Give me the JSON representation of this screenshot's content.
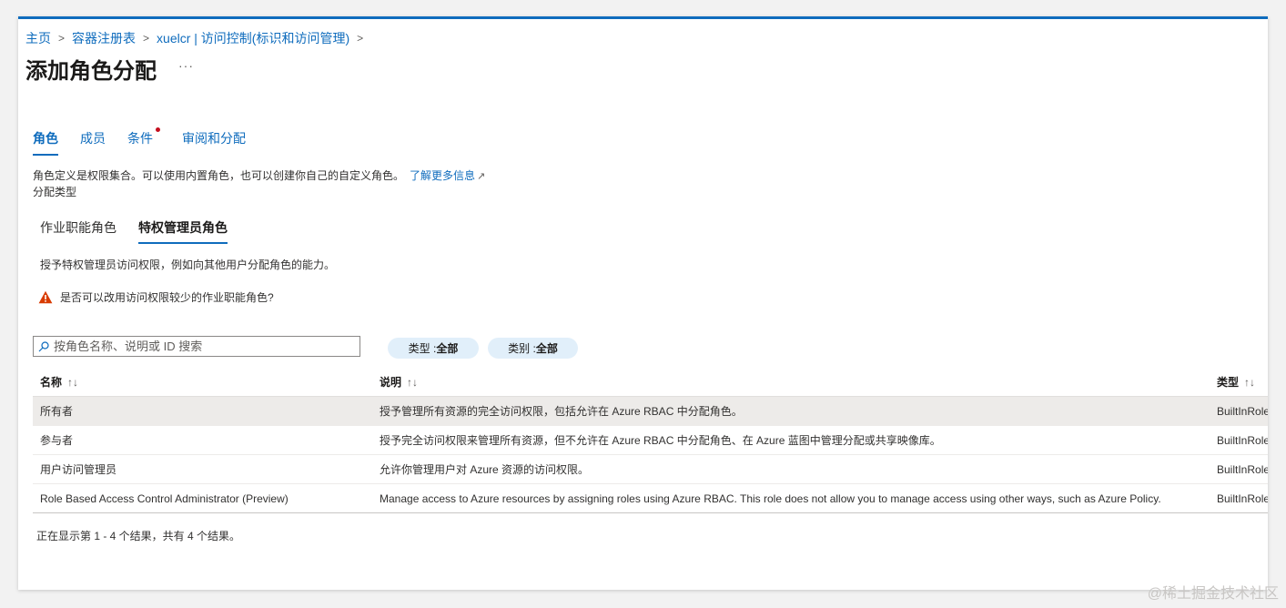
{
  "breadcrumb": {
    "items": [
      {
        "label": "主页"
      },
      {
        "label": "容器注册表"
      },
      {
        "label": "xuelcr | 访问控制(标识和访问管理)"
      }
    ]
  },
  "page": {
    "title": "添加角色分配",
    "more_label": "···"
  },
  "tabs": [
    {
      "label": "角色"
    },
    {
      "label": "成员"
    },
    {
      "label": "条件"
    },
    {
      "label": "审阅和分配"
    }
  ],
  "description": {
    "text": "角色定义是权限集合。可以使用内置角色，也可以创建你自己的自定义角色。",
    "link": "了解更多信息",
    "assign_type_label": "分配类型"
  },
  "subtabs": [
    {
      "label": "作业职能角色"
    },
    {
      "label": "特权管理员角色"
    }
  ],
  "subtab_description": "授予特权管理员访问权限，例如向其他用户分配角色的能力。",
  "warning": {
    "text": "是否可以改用访问权限较少的作业职能角色?",
    "color": "#d83b01"
  },
  "search": {
    "placeholder": "按角色名称、说明或 ID 搜索",
    "value": ""
  },
  "filters": [
    {
      "label": "类型 : ",
      "value": "全部"
    },
    {
      "label": "类别 : ",
      "value": "全部"
    }
  ],
  "table": {
    "columns": [
      {
        "label": "名称",
        "sort": "↑↓"
      },
      {
        "label": "说明",
        "sort": "↑↓"
      },
      {
        "label": "类型",
        "sort": "↑↓"
      }
    ],
    "rows": [
      {
        "name": "所有者",
        "description": "授予管理所有资源的完全访问权限，包括允许在 Azure RBAC 中分配角色。",
        "type": "BuiltInRole"
      },
      {
        "name": "参与者",
        "description": "授予完全访问权限来管理所有资源，但不允许在 Azure RBAC 中分配角色、在 Azure 蓝图中管理分配或共享映像库。",
        "type": "BuiltInRole"
      },
      {
        "name": "用户访问管理员",
        "description": "允许你管理用户对 Azure 资源的访问权限。",
        "type": "BuiltInRole"
      },
      {
        "name": "Role Based Access Control Administrator (Preview)",
        "description": "Manage access to Azure resources by assigning roles using Azure RBAC. This role does not allow you to manage access using other ways, such as Azure Policy.",
        "type": "BuiltInRole"
      }
    ]
  },
  "result_count": "正在显示第 1 - 4 个结果，共有 4 个结果。",
  "watermark": "@稀土掘金技术社区",
  "colors": {
    "accent": "#0f6cbd",
    "required_dot": "#c50f1f",
    "pill_bg": "#e1effa",
    "selected_row": "#edebe9"
  }
}
